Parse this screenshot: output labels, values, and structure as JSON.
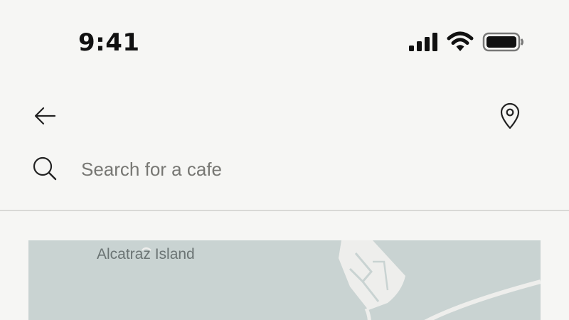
{
  "status_bar": {
    "time": "9:41",
    "icons": [
      "cellular-signal-icon",
      "wifi-icon",
      "battery-icon"
    ]
  },
  "toolbar": {
    "back_icon": "arrow-left-icon",
    "location_icon": "map-pin-icon"
  },
  "search": {
    "icon": "search-icon",
    "value": "",
    "placeholder": "Search for a cafe"
  },
  "map": {
    "label": "Alcatraz Island",
    "colors": {
      "water": "#c9d3d2",
      "land": "#eeeeec"
    }
  },
  "colors": {
    "background": "#f6f6f4",
    "text": "#111111",
    "placeholder": "#777773",
    "divider": "#d9d9d6"
  }
}
